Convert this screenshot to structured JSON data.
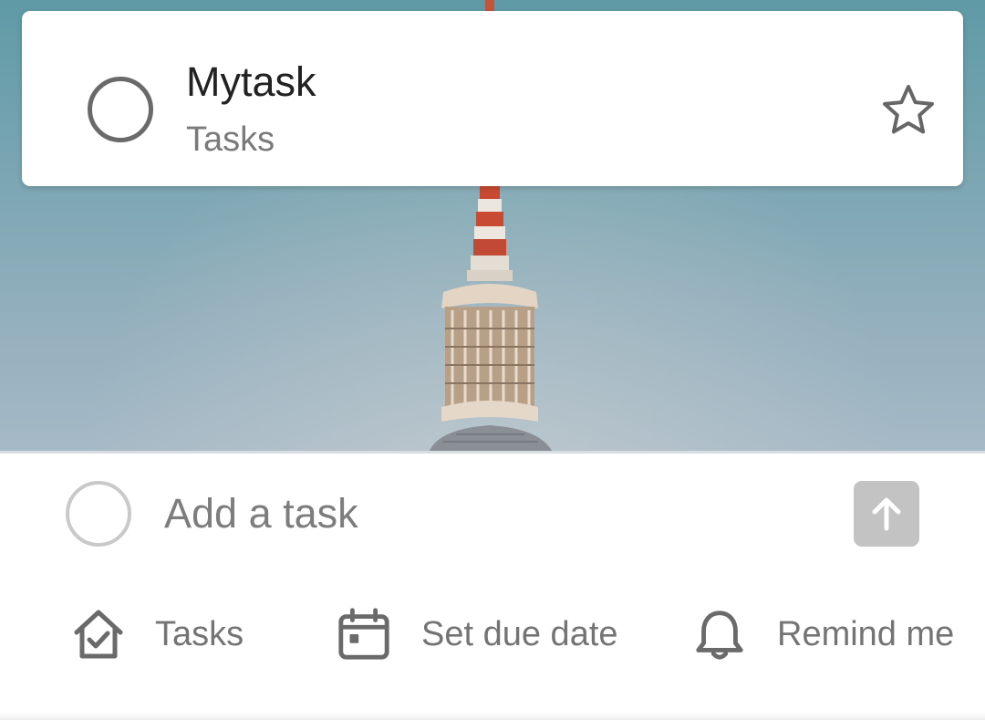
{
  "task": {
    "title": "Mytask",
    "list_name": "Tasks",
    "complete_icon": "circle-outline-icon",
    "star_icon": "star-outline-icon"
  },
  "add_task": {
    "placeholder": "Add a task",
    "complete_icon": "circle-outline-icon",
    "submit_icon": "arrow-up-icon"
  },
  "options": [
    {
      "label": "Tasks",
      "icon": "home-check-icon"
    },
    {
      "label": "Set due date",
      "icon": "calendar-icon"
    },
    {
      "label": "Remind me",
      "icon": "bell-icon"
    }
  ],
  "colors": {
    "icon": "#6a6a6a",
    "label": "#747474",
    "submit_bg": "#c3c3c3",
    "sky": "#78a5b1"
  }
}
